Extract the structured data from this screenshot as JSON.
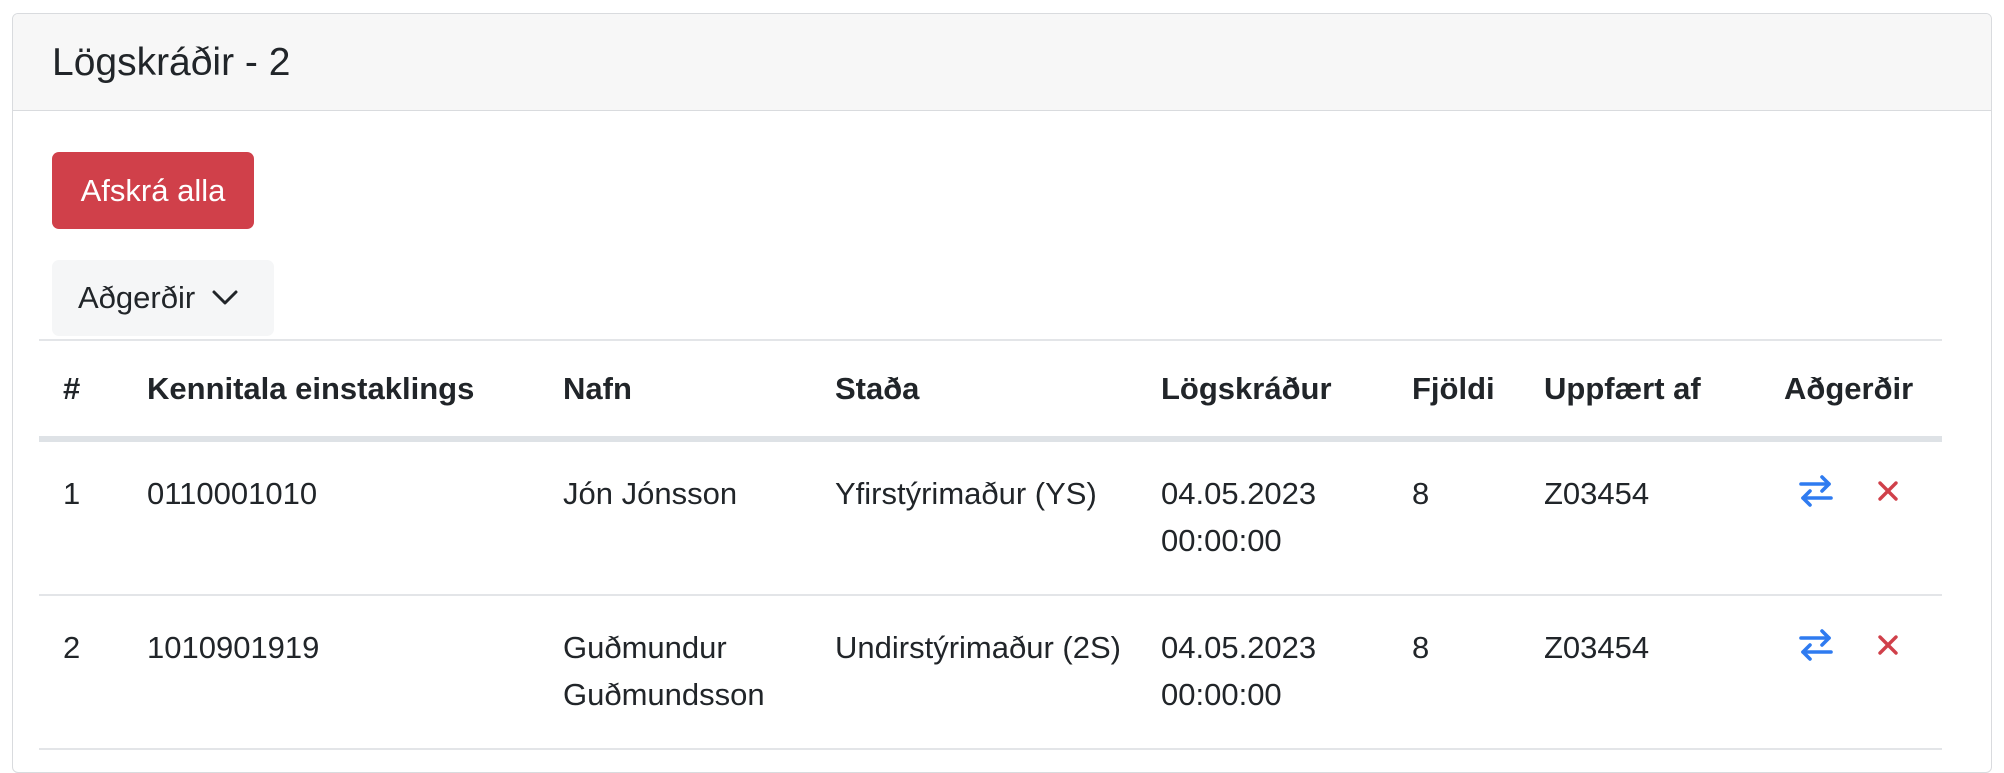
{
  "card": {
    "title": "Lögskráðir - 2"
  },
  "buttons": {
    "unregister_all": "Afskrá alla",
    "actions_dropdown": "Aðgerðir"
  },
  "table": {
    "columns": [
      "#",
      "Kennitala einstaklings",
      "Nafn",
      "Staða",
      "Lögskráður",
      "Fjöldi",
      "Uppfært af",
      "Aðgerðir"
    ],
    "rows": [
      {
        "num": "1",
        "kennitala": "0110001010",
        "nafn": "Jón Jónsson",
        "stada": "Yfirstýrimaður (YS)",
        "date": "04.05.2023",
        "time": "00:00:00",
        "fjoldi": "8",
        "uppfaert_af": "Z03454"
      },
      {
        "num": "2",
        "kennitala": "1010901919",
        "nafn": "Guðmundur Guðmundsson",
        "stada": "Undirstýrimaður (2S)",
        "date": "04.05.2023",
        "time": "00:00:00",
        "fjoldi": "8",
        "uppfaert_af": "Z03454"
      }
    ]
  },
  "icons": {
    "swap": "arrows-swap-icon",
    "delete": "close-x-icon"
  },
  "colors": {
    "danger": "#d0404a",
    "primary_icon": "#2f7bf0",
    "delete_icon": "#d0404a"
  }
}
